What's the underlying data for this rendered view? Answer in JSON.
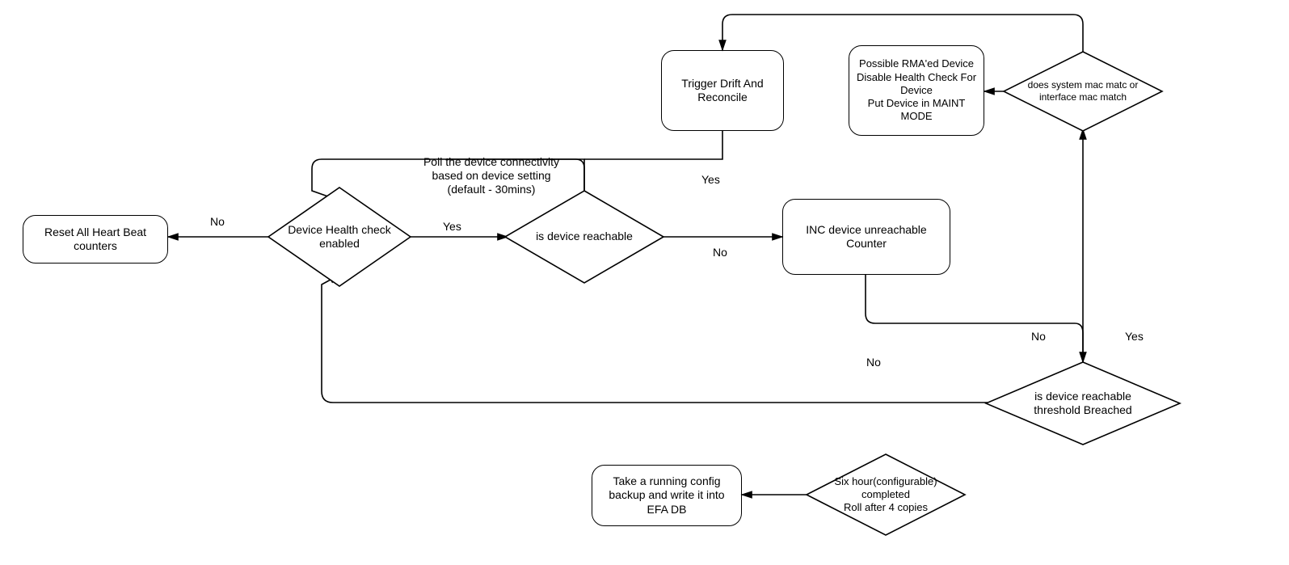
{
  "nodes": {
    "reset_counters": {
      "text": "Reset All Heart Beat counters"
    },
    "health_check_enabled": {
      "text": "Device Health check enabled"
    },
    "is_reachable": {
      "text": "is device reachable"
    },
    "inc_counter": {
      "text": "INC device unreachable Counter"
    },
    "trigger_drift": {
      "text": "Trigger Drift And Reconcile"
    },
    "rma_actions": {
      "text": "Possible RMA'ed Device\nDisable Health Check For Device\nPut Device in MAINT MODE"
    },
    "mac_match": {
      "text": "does  system mac matc or interface mac match"
    },
    "threshold_breached": {
      "text": "is device reachable threshold Breached"
    },
    "six_hour": {
      "text": "Six hour(configurable)\ncompleted\nRoll after 4 copies"
    },
    "take_backup": {
      "text": "Take a running config backup and write it into EFA DB"
    }
  },
  "labels": {
    "poll_caption": "Poll the device connectivity\nbased on device setting\n(default - 30mins)",
    "no_left": "No",
    "yes_mid": "Yes",
    "yes_upper": "Yes",
    "no_upper": "No",
    "no_lower": "No",
    "threshold_no": "No",
    "threshold_yes": "Yes"
  },
  "chart_data": {
    "type": "flowchart",
    "nodes": [
      {
        "id": "reset_counters",
        "kind": "process",
        "text": "Reset All Heart Beat counters"
      },
      {
        "id": "health_check_enabled",
        "kind": "decision",
        "text": "Device Health check enabled"
      },
      {
        "id": "is_reachable",
        "kind": "decision",
        "text": "is device reachable",
        "caption": "Poll the device connectivity based on device setting (default - 30mins)"
      },
      {
        "id": "inc_counter",
        "kind": "process",
        "text": "INC device unreachable Counter"
      },
      {
        "id": "trigger_drift",
        "kind": "process",
        "text": "Trigger Drift And Reconcile"
      },
      {
        "id": "rma_actions",
        "kind": "process",
        "text": "Possible RMA'ed Device; Disable Health Check For Device; Put Device in MAINT MODE"
      },
      {
        "id": "mac_match",
        "kind": "decision",
        "text": "does system mac match or interface mac match"
      },
      {
        "id": "threshold_breached",
        "kind": "decision",
        "text": "is device reachable threshold Breached"
      },
      {
        "id": "six_hour",
        "kind": "decision",
        "text": "Six hour (configurable) completed; Roll after 4 copies"
      },
      {
        "id": "take_backup",
        "kind": "process",
        "text": "Take a running config backup and write it into EFA DB"
      }
    ],
    "edges": [
      {
        "from": "health_check_enabled",
        "to": "reset_counters",
        "label": "No"
      },
      {
        "from": "health_check_enabled",
        "to": "is_reachable",
        "label": "Yes"
      },
      {
        "from": "is_reachable",
        "to": "trigger_drift",
        "label": "Yes",
        "note": "via top loop"
      },
      {
        "from": "is_reachable",
        "to": "inc_counter",
        "label": "No"
      },
      {
        "from": "inc_counter",
        "to": "threshold_breached",
        "label": ""
      },
      {
        "from": "threshold_breached",
        "to": "health_check_enabled",
        "label": "No",
        "note": "loop back"
      },
      {
        "from": "threshold_breached",
        "to": "mac_match",
        "label": "Yes"
      },
      {
        "from": "mac_match",
        "to": "rma_actions",
        "label": "",
        "note": "left output"
      },
      {
        "from": "mac_match",
        "to": "trigger_drift",
        "label": "",
        "note": "top output"
      },
      {
        "from": "trigger_drift",
        "to": "health_check_enabled",
        "label": "",
        "note": "loop back"
      },
      {
        "from": "six_hour",
        "to": "take_backup",
        "label": ""
      }
    ]
  }
}
